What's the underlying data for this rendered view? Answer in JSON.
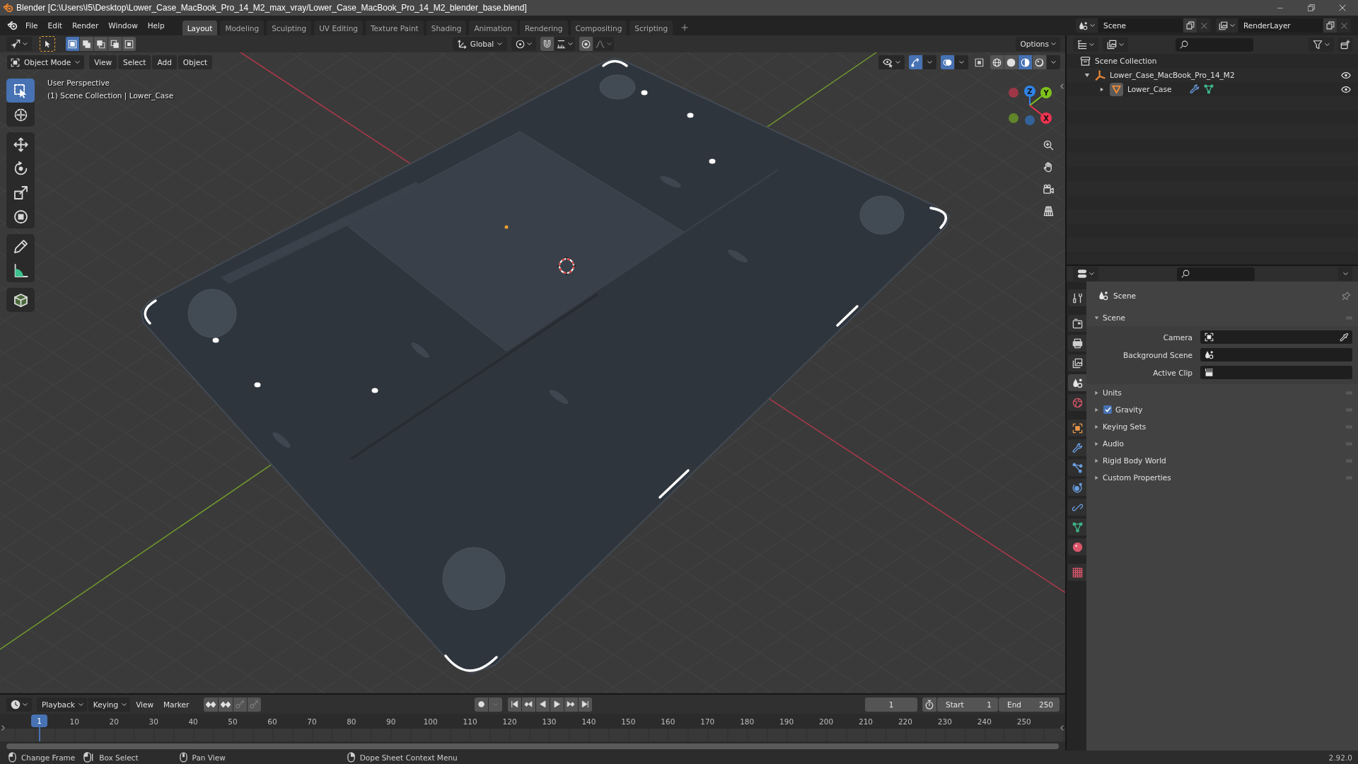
{
  "window": {
    "title": "Blender [C:\\Users\\I5\\Desktop\\Lower_Case_MacBook_Pro_14_M2_max_vray/Lower_Case_MacBook_Pro_14_M2_blender_base.blend]"
  },
  "menu": [
    "File",
    "Edit",
    "Render",
    "Window",
    "Help"
  ],
  "workspaces": [
    {
      "label": "Layout",
      "selected": true
    },
    {
      "label": "Modeling",
      "selected": false
    },
    {
      "label": "Sculpting",
      "selected": false
    },
    {
      "label": "UV Editing",
      "selected": false
    },
    {
      "label": "Texture Paint",
      "selected": false
    },
    {
      "label": "Shading",
      "selected": false
    },
    {
      "label": "Animation",
      "selected": false
    },
    {
      "label": "Rendering",
      "selected": false
    },
    {
      "label": "Compositing",
      "selected": false
    },
    {
      "label": "Scripting",
      "selected": false
    }
  ],
  "scene_selector": {
    "scene": "Scene",
    "view_layer": "RenderLayer"
  },
  "viewport": {
    "tool_settings": {
      "select_modes": [
        {
          "kind": "set",
          "selected": true
        },
        {
          "kind": "extend",
          "selected": false
        },
        {
          "kind": "subtract",
          "selected": false
        },
        {
          "kind": "difference",
          "selected": false
        },
        {
          "kind": "intersect",
          "selected": false
        }
      ],
      "orientation": "Global",
      "options": "Options"
    },
    "header": {
      "mode": "Object Mode",
      "menus": [
        "View",
        "Select",
        "Add",
        "Object"
      ],
      "toggles": [
        {
          "kind": "gizmos",
          "on": true
        },
        {
          "kind": "overlays",
          "on": true
        },
        {
          "kind": "xray",
          "on": false
        }
      ],
      "shading": [
        {
          "kind": "wireframe",
          "selected": false
        },
        {
          "kind": "solid",
          "selected": false
        },
        {
          "kind": "material",
          "selected": true
        },
        {
          "kind": "rendered",
          "selected": false
        }
      ]
    },
    "info": [
      "User Perspective",
      "(1) Scene Collection | Lower_Case"
    ],
    "tools": [
      {
        "kind": "select",
        "selected": true
      },
      {
        "kind": "cursor",
        "selected": false
      },
      {
        "kind": "move",
        "selected": false
      },
      {
        "kind": "rotate",
        "selected": false
      },
      {
        "kind": "scale",
        "selected": false
      },
      {
        "kind": "transform",
        "selected": false
      },
      {
        "kind": "annotate",
        "selected": false
      },
      {
        "kind": "measure",
        "selected": false
      },
      {
        "kind": "add_cube",
        "selected": false
      }
    ],
    "gizmo_axes": [
      {
        "label": "Z",
        "color": "#2f83e8"
      },
      {
        "label": "Y",
        "color": "#7ec21c"
      },
      {
        "label": "X",
        "color": "#ee3450"
      }
    ]
  },
  "outliner": {
    "tree": [
      {
        "label": "Scene Collection",
        "kind": "collection",
        "children": [
          {
            "label": "Lower_Case_MacBook_Pro_14_M2",
            "kind": "empty",
            "expanded": true,
            "visible": true,
            "children": [
              {
                "label": "Lower_Case",
                "kind": "mesh",
                "expanded": false,
                "visible": true
              }
            ]
          }
        ]
      }
    ]
  },
  "properties": {
    "tabs": [
      {
        "kind": "tool",
        "selected": false
      },
      {
        "kind": "render",
        "selected": false
      },
      {
        "kind": "output",
        "selected": false
      },
      {
        "kind": "view_layer",
        "selected": false
      },
      {
        "kind": "scene",
        "selected": true
      },
      {
        "kind": "world",
        "selected": false
      },
      {
        "kind": "object",
        "selected": false
      },
      {
        "kind": "modifiers",
        "selected": false
      },
      {
        "kind": "particles",
        "selected": false
      },
      {
        "kind": "physics",
        "selected": false
      },
      {
        "kind": "constraints",
        "selected": false
      },
      {
        "kind": "data",
        "selected": false
      },
      {
        "kind": "material",
        "selected": false
      },
      {
        "kind": "texture",
        "selected": false
      }
    ],
    "context": "Scene",
    "panels": [
      {
        "label": "Scene",
        "expanded": true,
        "fields": [
          {
            "label": "Camera",
            "kind": "camera"
          },
          {
            "label": "Background Scene",
            "kind": "scene"
          },
          {
            "label": "Active Clip",
            "kind": "clip"
          }
        ]
      },
      {
        "label": "Units",
        "expanded": false
      },
      {
        "label": "Gravity",
        "expanded": false,
        "checkbox": {
          "checked": true
        }
      },
      {
        "label": "Keying Sets",
        "expanded": false
      },
      {
        "label": "Audio",
        "expanded": false
      },
      {
        "label": "Rigid Body World",
        "expanded": false
      },
      {
        "label": "Custom Properties",
        "expanded": false
      }
    ]
  },
  "timeline": {
    "menus": [
      {
        "label": "Playback",
        "kind": "dropdown"
      },
      {
        "label": "Keying",
        "kind": "dropdown"
      },
      {
        "label": "View",
        "kind": "menu"
      },
      {
        "label": "Marker",
        "kind": "menu"
      }
    ],
    "current_frame": "1",
    "start": {
      "label": "Start",
      "value": "1"
    },
    "end": {
      "label": "End",
      "value": "250"
    },
    "playhead": "1",
    "ruler": [
      "10",
      "20",
      "30",
      "40",
      "50",
      "60",
      "70",
      "80",
      "90",
      "100",
      "110",
      "120",
      "130",
      "140",
      "150",
      "160",
      "170",
      "180",
      "190",
      "200",
      "210",
      "220",
      "230",
      "240",
      "250"
    ]
  },
  "status_bar": {
    "hints": [
      {
        "label": "Change Frame",
        "kind": "left_click"
      },
      {
        "label": "Box Select",
        "kind": "drag"
      },
      {
        "label": "Pan View",
        "kind": "middle_click"
      },
      {
        "label": "Dope Sheet Context Menu",
        "kind": "right_click"
      }
    ],
    "version": "2.92.0"
  }
}
